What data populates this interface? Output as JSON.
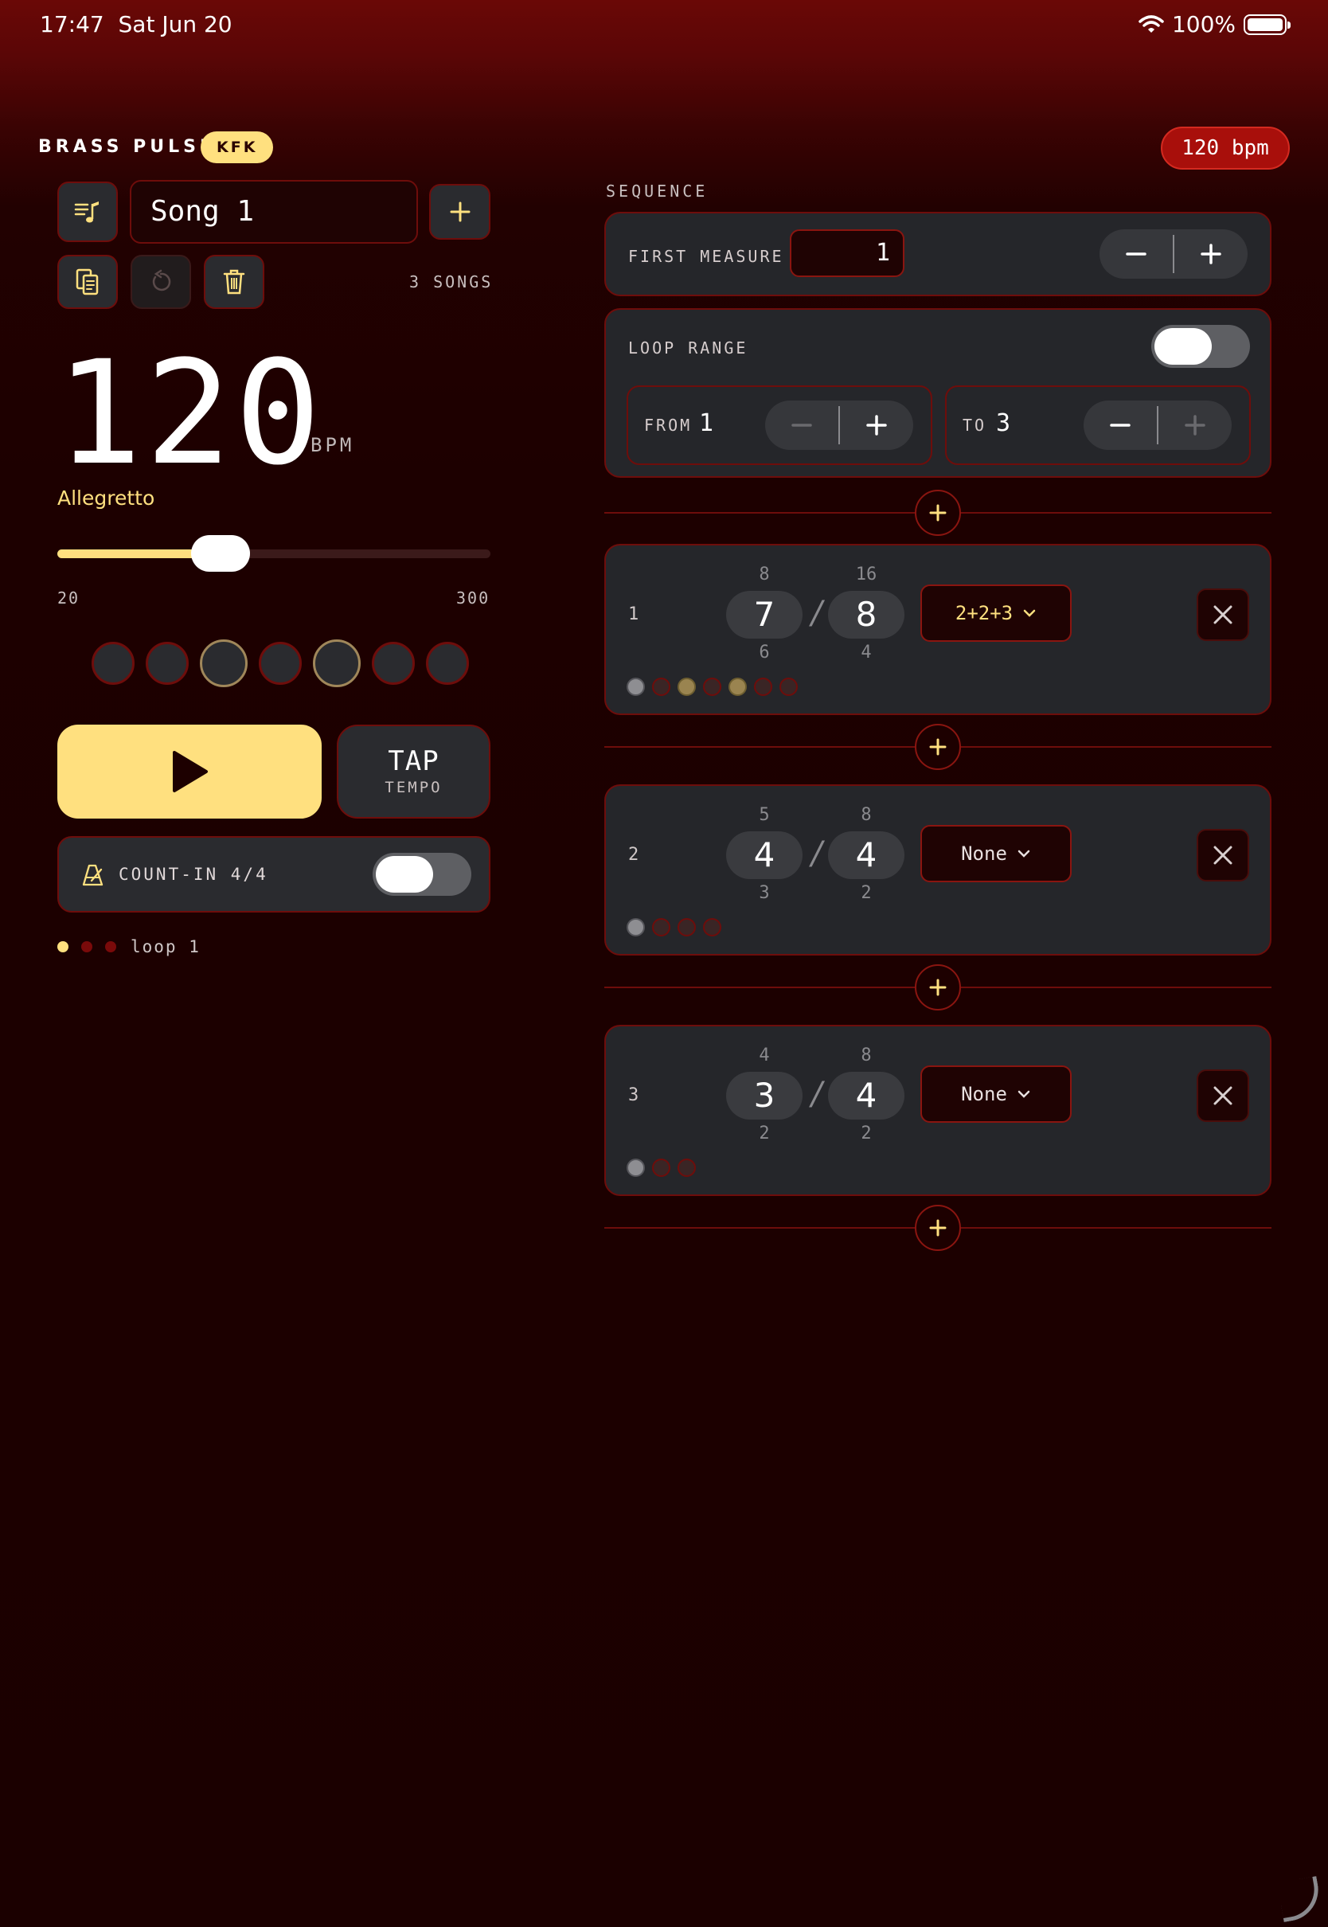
{
  "status": {
    "time": "17:47",
    "date": "Sat Jun 20",
    "battery": "100%"
  },
  "header": {
    "brand": "BRASS PULSE",
    "badge": "KFK",
    "bpm_pill": "120 bpm"
  },
  "song": {
    "name": "Song 1",
    "count": "3 SONGS"
  },
  "tempo": {
    "bpm": "120",
    "unit": "BPM",
    "marking": "Allegretto",
    "min": "20",
    "max": "300",
    "value": 120
  },
  "beats": {
    "count": 7,
    "accents": [
      3,
      5
    ]
  },
  "transport": {
    "tap_main": "TAP",
    "tap_sub": "TEMPO"
  },
  "count_in": {
    "label": "COUNT-IN 4/4",
    "enabled": false
  },
  "loop_status": {
    "label": "loop 1",
    "dots": 3,
    "active": 1
  },
  "sequence": {
    "label": "SEQUENCE",
    "first_measure": {
      "label": "FIRST MEASURE",
      "value": "1"
    },
    "loop_range": {
      "label": "LOOP RANGE",
      "enabled": false,
      "from_label": "FROM",
      "from_value": "1",
      "to_label": "TO",
      "to_value": "3"
    },
    "measures": [
      {
        "index": "1",
        "num": "7",
        "num_above": "8",
        "num_below": "6",
        "den": "8",
        "den_above": "16",
        "den_below": "4",
        "grouping": "2+2+3",
        "beats": 7,
        "accents": [
          3,
          5
        ]
      },
      {
        "index": "2",
        "num": "4",
        "num_above": "5",
        "num_below": "3",
        "den": "4",
        "den_above": "8",
        "den_below": "2",
        "grouping": "None",
        "beats": 4,
        "accents": []
      },
      {
        "index": "3",
        "num": "3",
        "num_above": "4",
        "num_below": "2",
        "den": "4",
        "den_above": "8",
        "den_below": "2",
        "grouping": "None",
        "beats": 3,
        "accents": []
      }
    ]
  },
  "colors": {
    "accent": "#ffe07f",
    "border": "#6e0d0b",
    "card": "#25262a",
    "pill": "#a80f0b"
  }
}
